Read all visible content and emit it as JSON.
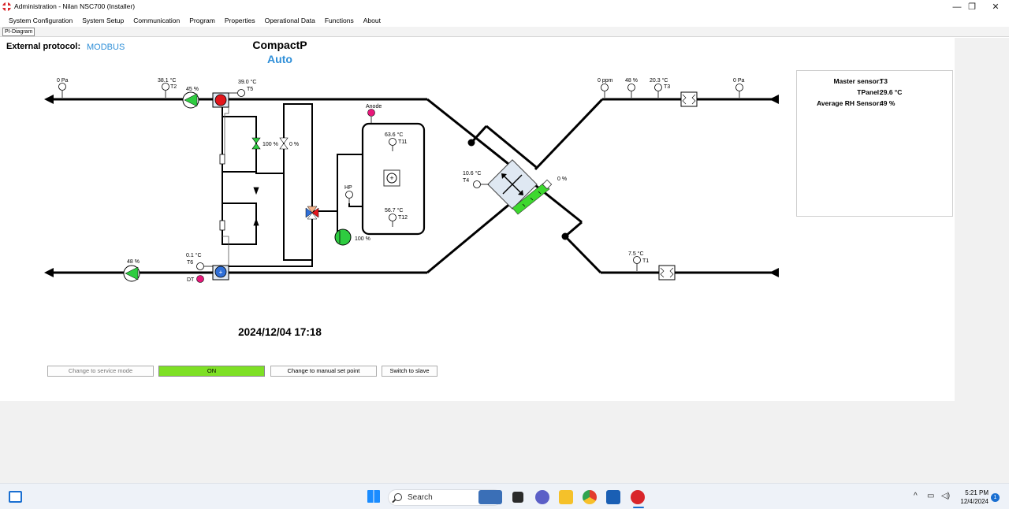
{
  "window": {
    "title": "Administration - Nilan NSC700 (Installer)",
    "min": "—",
    "restore": "❐",
    "close": "✕"
  },
  "menu": [
    "System Configuration",
    "System Setup",
    "Communication",
    "Program",
    "Properties",
    "Operational Data",
    "Functions",
    "About"
  ],
  "tab": "PI-Diagram",
  "header": {
    "protocol_label": "External protocol:",
    "protocol_value": "MODBUS",
    "model": "CompactP",
    "mode": "Auto"
  },
  "diagram": {
    "pressure_exhaust": "0 Pa",
    "t2_value": "38.1 °C",
    "t2_label": "T2",
    "exhaust_fan_pct": "45 %",
    "t5_value": "39.0 °C",
    "t5_label": "T5",
    "anode_label": "Anode",
    "valve_green_pct": "100 %",
    "valve_white_pct": "0 %",
    "t11_value": "63.6 °C",
    "t11_label": "T11",
    "hp_label": "HP",
    "t12_value": "56.7 °C",
    "t12_label": "T12",
    "compressor_pct": "100 %",
    "t4_value": "10.6 °C",
    "t4_label": "T4",
    "bypass_pct": "0 %",
    "co2_value": "0 ppm",
    "rh_value": "48 %",
    "t3_value": "20.3 °C",
    "t3_label": "T3",
    "pressure_intake": "0 Pa",
    "t6_value": "0.1 °C",
    "t6_label": "T6",
    "dt_label": "DT",
    "supply_fan_pct": "48 %",
    "t1_value": "7.5 °C",
    "t1_label": "T1"
  },
  "info": {
    "rows": [
      {
        "key": "Master sensor:",
        "value": "T3"
      },
      {
        "key": "TPanel:",
        "value": "29.6 °C"
      },
      {
        "key": "Average RH Sensor:",
        "value": "49 %"
      }
    ]
  },
  "datetime": "2024/12/04 17:18",
  "buttons": {
    "service": "Change to service mode",
    "on": "ON",
    "manual": "Change to manual set point",
    "slave": "Switch to slave"
  },
  "taskbar": {
    "search_placeholder": "Search",
    "time": "5:21 PM",
    "date": "12/4/2024",
    "notifications": "1",
    "colors": {
      "accent": "#7ee025",
      "red": "#e3161c",
      "blue": "#2f8fd8"
    }
  }
}
